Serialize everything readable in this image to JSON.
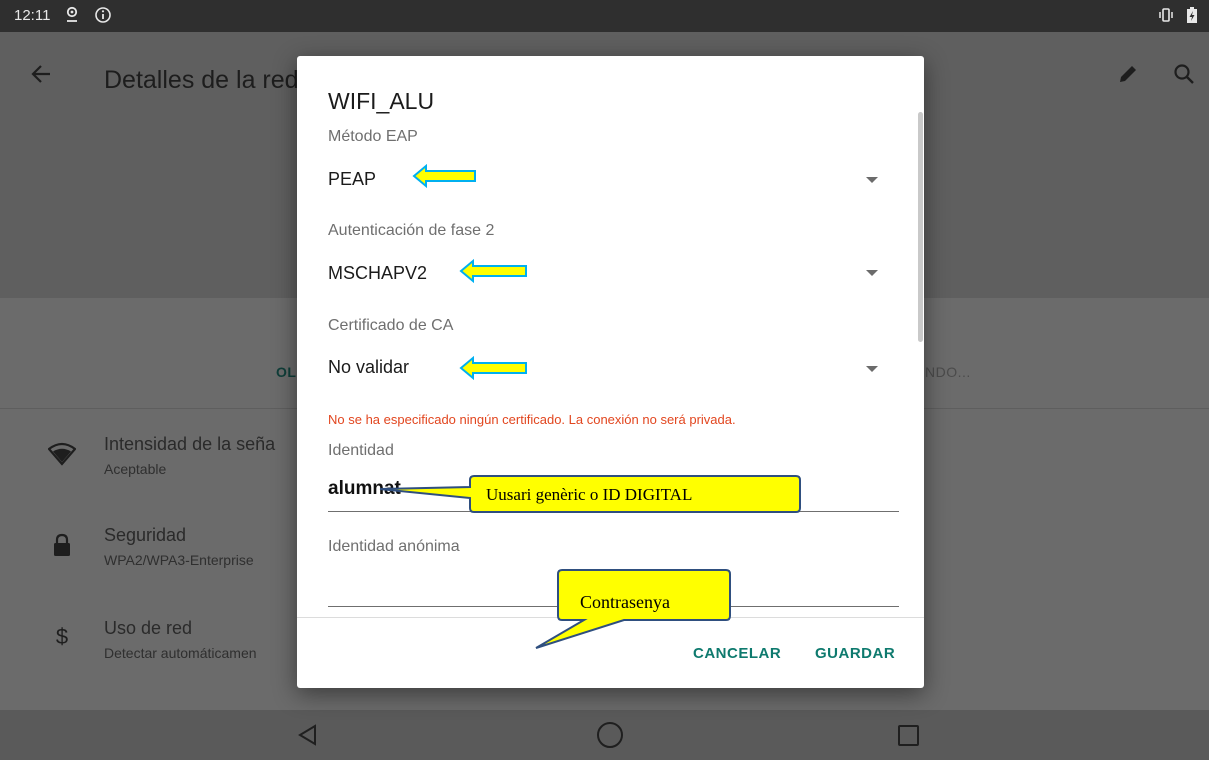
{
  "status_bar": {
    "time": "12:11",
    "icons": [
      "location-icon",
      "info-icon",
      "vibrate-icon",
      "battery-charging-icon"
    ]
  },
  "app_bar": {
    "title": "Detalles de la red",
    "back_icon": "arrow-back-icon",
    "edit_icon": "pencil-icon",
    "search_icon": "search-icon"
  },
  "background_buttons": {
    "left_label": "OL",
    "right_label": "NDO..."
  },
  "details": [
    {
      "icon": "wifi-icon",
      "title": "Intensidad de la seña",
      "subtitle": "Aceptable"
    },
    {
      "icon": "lock-icon",
      "title": "Seguridad",
      "subtitle": "WPA2/WPA3-Enterprise"
    },
    {
      "icon": "dollar-icon",
      "title": "Uso de red",
      "subtitle": "Detectar automáticamen"
    }
  ],
  "dialog": {
    "title": "WIFI_ALU",
    "eap_method": {
      "label": "Método EAP",
      "value": "PEAP"
    },
    "phase2": {
      "label": "Autenticación de fase 2",
      "value": "MSCHAPV2"
    },
    "ca_cert": {
      "label": "Certificado de CA",
      "value": "No validar"
    },
    "warning": "No se ha especificado ningún certificado. La conexión no será privada.",
    "identity": {
      "label": "Identidad",
      "value": "alumnat"
    },
    "anonymous_identity": {
      "label": "Identidad anónima",
      "value": ""
    },
    "cancel_label": "CANCELAR",
    "save_label": "GUARDAR"
  },
  "annotations": {
    "identity_callout": "Uusari genèric o ID DIGITAL",
    "password_callout": "Contrasenya",
    "arrow_fill": "#ffff00",
    "arrow_stroke": "#00b0f0",
    "callout_fill": "#ffff00",
    "callout_stroke": "#2f4f7f"
  },
  "colors": {
    "accent": "#0e7a6e",
    "warning": "#e2461f"
  }
}
